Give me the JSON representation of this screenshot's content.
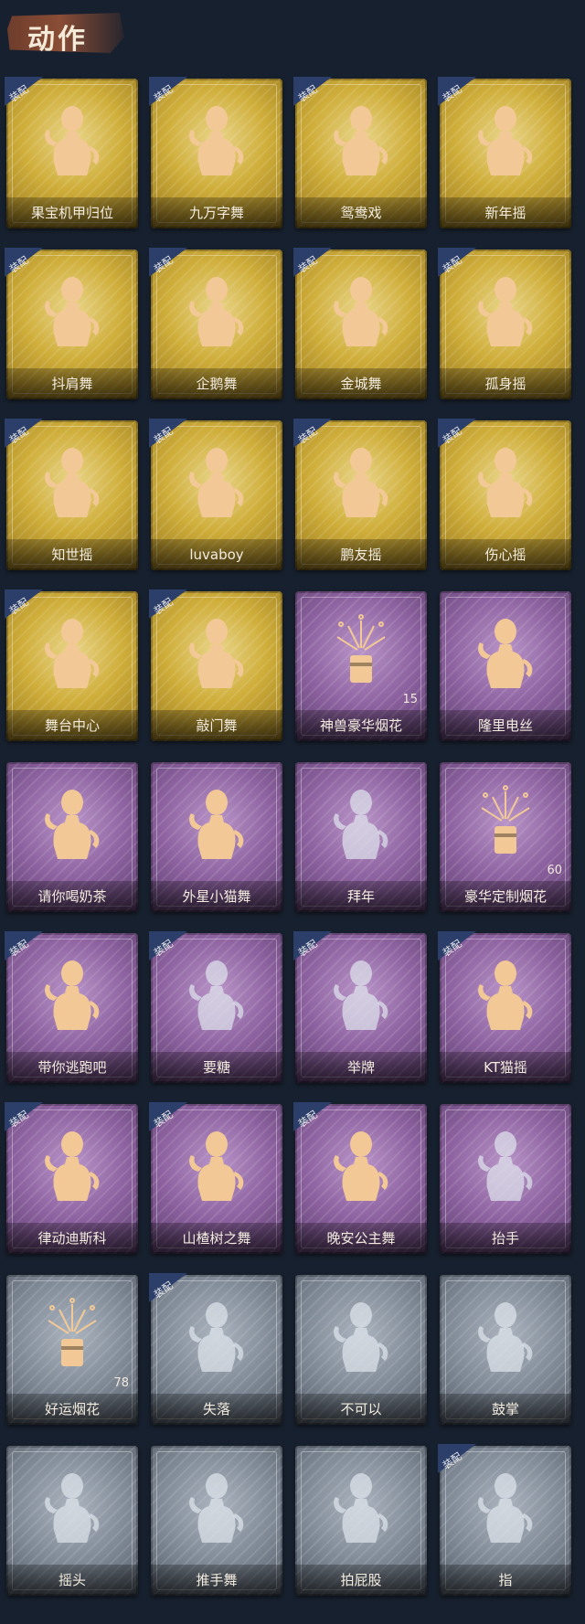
{
  "header": {
    "title": "动作"
  },
  "badge_text": "装配",
  "colors": {
    "gold": "#cfae3a",
    "purple": "#8d62a0",
    "gray": "#7d8793",
    "figure": "#f2c896",
    "badge": "#2c3e6a"
  },
  "cards": [
    {
      "label": "果宝机甲归位",
      "tier": "gold",
      "equipped": true,
      "icon": "figure",
      "count": ""
    },
    {
      "label": "九万字舞",
      "tier": "gold",
      "equipped": true,
      "icon": "figure",
      "count": ""
    },
    {
      "label": "鸳鸯戏",
      "tier": "gold",
      "equipped": true,
      "icon": "figure",
      "count": ""
    },
    {
      "label": "新年摇",
      "tier": "gold",
      "equipped": true,
      "icon": "figure",
      "count": ""
    },
    {
      "label": "抖肩舞",
      "tier": "gold",
      "equipped": true,
      "icon": "figure",
      "count": ""
    },
    {
      "label": "企鹅舞",
      "tier": "gold",
      "equipped": true,
      "icon": "figure",
      "count": ""
    },
    {
      "label": "金城舞",
      "tier": "gold",
      "equipped": true,
      "icon": "figure",
      "count": ""
    },
    {
      "label": "孤身摇",
      "tier": "gold",
      "equipped": true,
      "icon": "figure",
      "count": ""
    },
    {
      "label": "知世摇",
      "tier": "gold",
      "equipped": true,
      "icon": "figure",
      "count": ""
    },
    {
      "label": "luvaboy",
      "tier": "gold",
      "equipped": true,
      "icon": "figure",
      "count": ""
    },
    {
      "label": "鹏友摇",
      "tier": "gold",
      "equipped": true,
      "icon": "figure",
      "count": ""
    },
    {
      "label": "伤心摇",
      "tier": "gold",
      "equipped": true,
      "icon": "figure",
      "count": ""
    },
    {
      "label": "舞台中心",
      "tier": "gold",
      "equipped": true,
      "icon": "figure",
      "count": ""
    },
    {
      "label": "敲门舞",
      "tier": "gold",
      "equipped": true,
      "icon": "figure",
      "count": ""
    },
    {
      "label": "神兽豪华烟花",
      "tier": "purple",
      "equipped": false,
      "icon": "firework",
      "count": "15"
    },
    {
      "label": "隆里电丝",
      "tier": "purple",
      "equipped": false,
      "icon": "figure",
      "count": ""
    },
    {
      "label": "请你喝奶茶",
      "tier": "purple",
      "equipped": false,
      "icon": "figure",
      "count": ""
    },
    {
      "label": "外星小猫舞",
      "tier": "purple",
      "equipped": false,
      "icon": "figure",
      "count": ""
    },
    {
      "label": "拜年",
      "tier": "purple",
      "equipped": false,
      "icon": "figure-locked",
      "count": ""
    },
    {
      "label": "豪华定制烟花",
      "tier": "purple",
      "equipped": false,
      "icon": "firework",
      "count": "60"
    },
    {
      "label": "带你逃跑吧",
      "tier": "purple",
      "equipped": true,
      "icon": "figure",
      "count": ""
    },
    {
      "label": "要糖",
      "tier": "purple",
      "equipped": true,
      "icon": "figure-locked",
      "count": ""
    },
    {
      "label": "举牌",
      "tier": "purple",
      "equipped": true,
      "icon": "figure-locked",
      "count": ""
    },
    {
      "label": "KT猫摇",
      "tier": "purple",
      "equipped": true,
      "icon": "figure",
      "count": ""
    },
    {
      "label": "律动迪斯科",
      "tier": "purple",
      "equipped": true,
      "icon": "figure",
      "count": ""
    },
    {
      "label": "山楂树之舞",
      "tier": "purple",
      "equipped": true,
      "icon": "figure",
      "count": ""
    },
    {
      "label": "晚安公主舞",
      "tier": "purple",
      "equipped": true,
      "icon": "figure",
      "count": ""
    },
    {
      "label": "抬手",
      "tier": "purple",
      "equipped": false,
      "icon": "figure-locked",
      "count": ""
    },
    {
      "label": "好运烟花",
      "tier": "gray",
      "equipped": false,
      "icon": "firework",
      "count": "78"
    },
    {
      "label": "失落",
      "tier": "gray",
      "equipped": true,
      "icon": "figure-locked",
      "count": ""
    },
    {
      "label": "不可以",
      "tier": "gray",
      "equipped": false,
      "icon": "figure-locked",
      "count": ""
    },
    {
      "label": "鼓掌",
      "tier": "gray",
      "equipped": false,
      "icon": "figure-locked",
      "count": ""
    },
    {
      "label": "摇头",
      "tier": "gray",
      "equipped": false,
      "icon": "figure-locked",
      "count": ""
    },
    {
      "label": "推手舞",
      "tier": "gray",
      "equipped": false,
      "icon": "figure-locked",
      "count": ""
    },
    {
      "label": "拍屁股",
      "tier": "gray",
      "equipped": false,
      "icon": "figure-locked",
      "count": ""
    },
    {
      "label": "指",
      "tier": "gray",
      "equipped": true,
      "icon": "figure-locked",
      "count": ""
    }
  ]
}
